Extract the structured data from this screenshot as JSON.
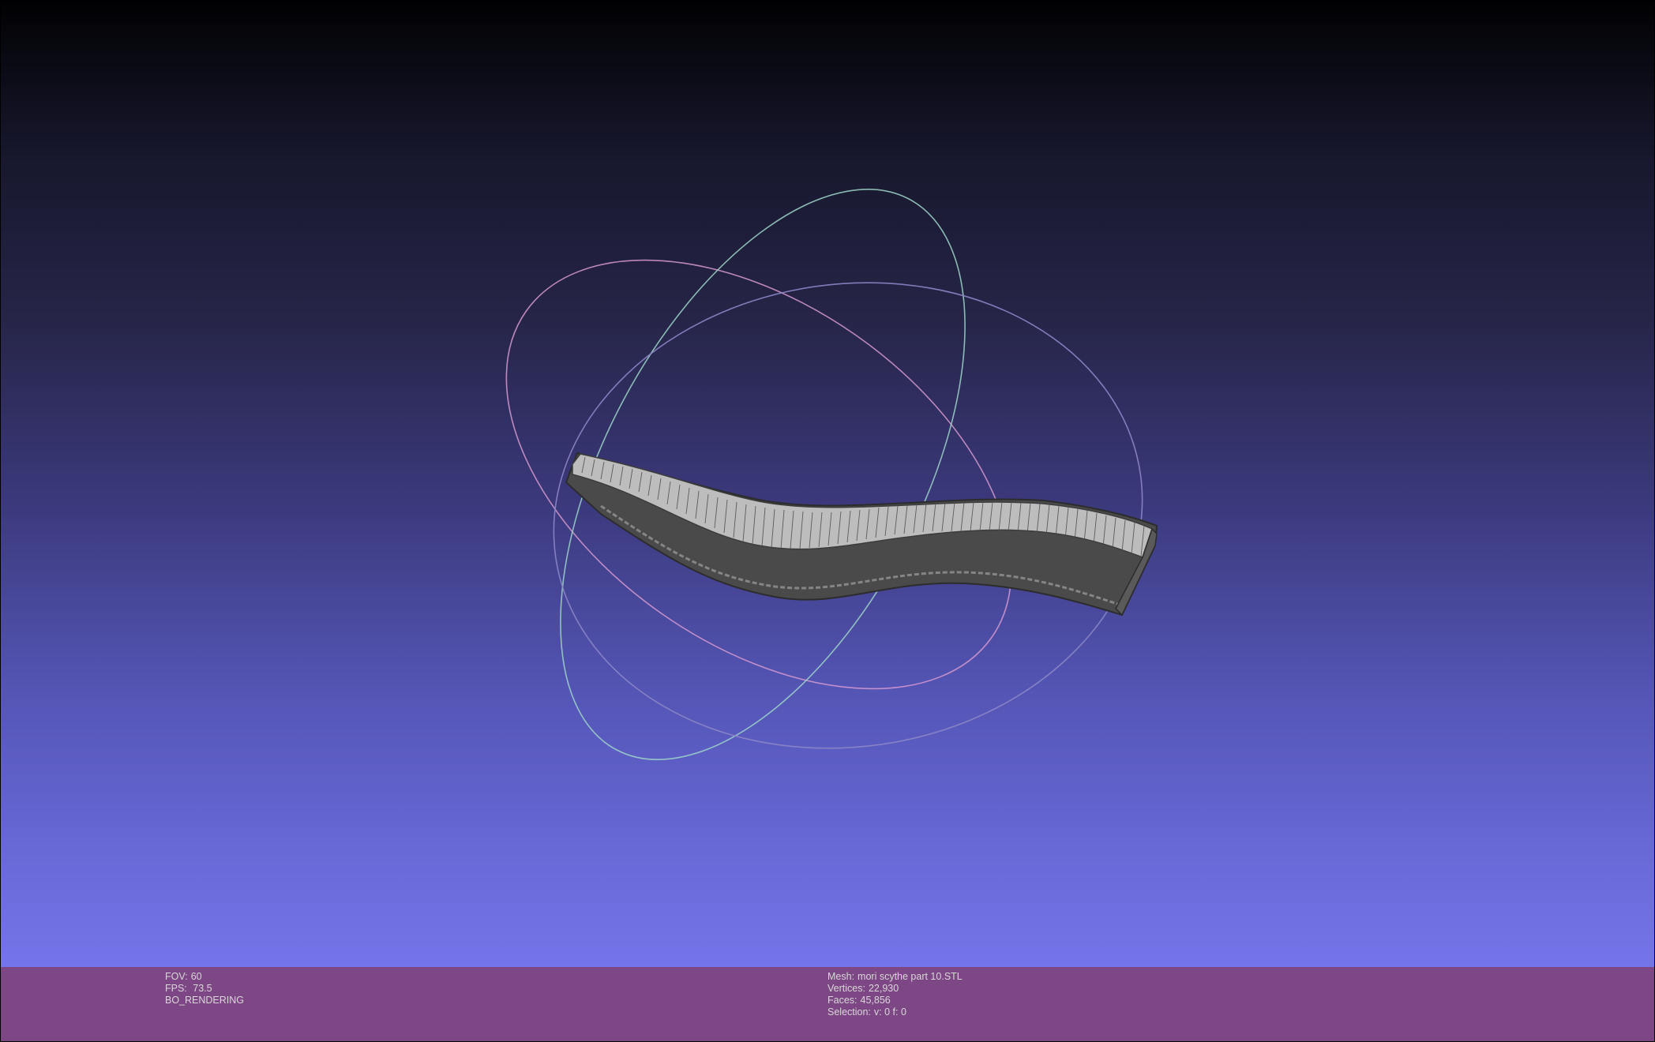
{
  "viewport": {
    "mesh_name": "mori scythe part 10.STL",
    "colors": {
      "background_top": "#010103",
      "background_bottom": "#7575ea",
      "status_bar": "#7d4684",
      "status_text": "#d8d8d8",
      "mesh_fill": "#bdbdbd",
      "mesh_edge": "#3c3c3c",
      "trackball_x": "#d79ad0",
      "trackball_y": "#9fd6c9",
      "trackball_z": "#8c86c6"
    },
    "icons": [
      "trackball-gizmo",
      "mesh-wireframe"
    ]
  },
  "status_left": {
    "fov_label": "FOV:",
    "fov_value": "60",
    "fps_label": "FPS:",
    "fps_value": " 73.5",
    "render_mode": "BO_RENDERING"
  },
  "status_right": {
    "mesh_label": "Mesh:",
    "mesh_value": "mori scythe part 10.STL",
    "vertices_label": "Vertices:",
    "vertices_value": "22,930",
    "faces_label": "Faces:",
    "faces_value": "45,856",
    "selection_label": "Selection:",
    "selection_value": "v: 0 f: 0"
  }
}
